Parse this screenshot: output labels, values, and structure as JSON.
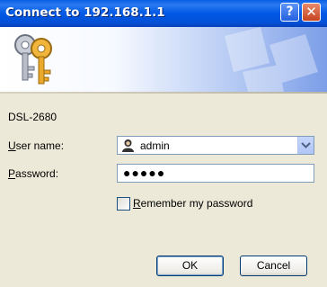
{
  "window": {
    "title": "Connect to 192.168.1.1"
  },
  "titlebar_buttons": {
    "help": "?",
    "close": "✕"
  },
  "device_name": "DSL-2680",
  "form": {
    "username_label_prefix": "U",
    "username_label_rest": "ser name:",
    "username_value": "admin",
    "password_label_prefix": "P",
    "password_label_rest": "assword:",
    "password_mask": "●●●●●",
    "remember_prefix": "R",
    "remember_rest": "emember my password",
    "remember_checked": false
  },
  "buttons": {
    "ok": "OK",
    "cancel": "Cancel"
  },
  "icons": {
    "banner": "keys-icon",
    "user": "user-icon",
    "dropdown": "chevron-down-icon"
  },
  "colors": {
    "titlebar": "#0058e6",
    "dialog_bg": "#ece9d8",
    "input_border": "#7f9db9"
  }
}
